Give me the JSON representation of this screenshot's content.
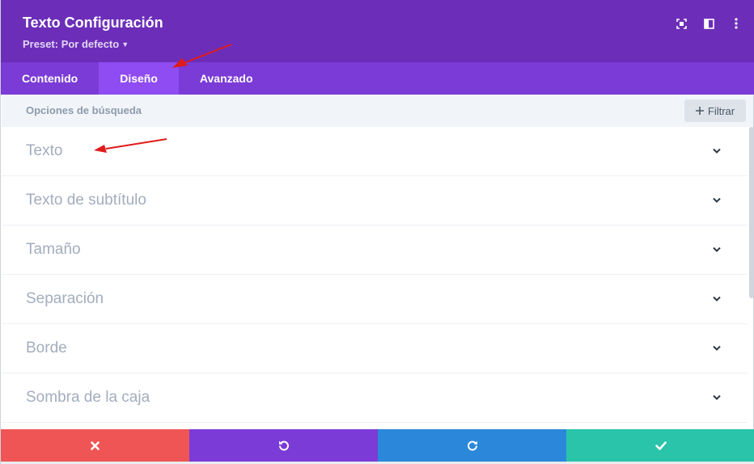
{
  "header": {
    "title": "Texto Configuración",
    "preset_label": "Preset: Por defecto",
    "icons": [
      "expand-icon",
      "split-view-icon",
      "more-vertical-icon"
    ]
  },
  "tabs": [
    {
      "label": "Contenido",
      "active": false
    },
    {
      "label": "Diseño",
      "active": true
    },
    {
      "label": "Avanzado",
      "active": false
    }
  ],
  "search": {
    "placeholder": "Opciones de búsqueda",
    "filter_label": "Filtrar"
  },
  "sections": [
    {
      "label": "Texto"
    },
    {
      "label": "Texto de subtítulo"
    },
    {
      "label": "Tamaño"
    },
    {
      "label": "Separación"
    },
    {
      "label": "Borde"
    },
    {
      "label": "Sombra de la caja"
    }
  ],
  "footer": {
    "buttons": [
      "cancel-icon",
      "undo-icon",
      "redo-icon",
      "check-icon"
    ]
  },
  "colors": {
    "header": "#6c2eb9",
    "tabs": "#7b3bd6",
    "active_tab": "#8f4cf2",
    "cancel": "#ef5555",
    "undo": "#7b3bd6",
    "redo": "#2b87da",
    "save": "#29c4a9",
    "annotation_arrow": "#e01b1b"
  }
}
